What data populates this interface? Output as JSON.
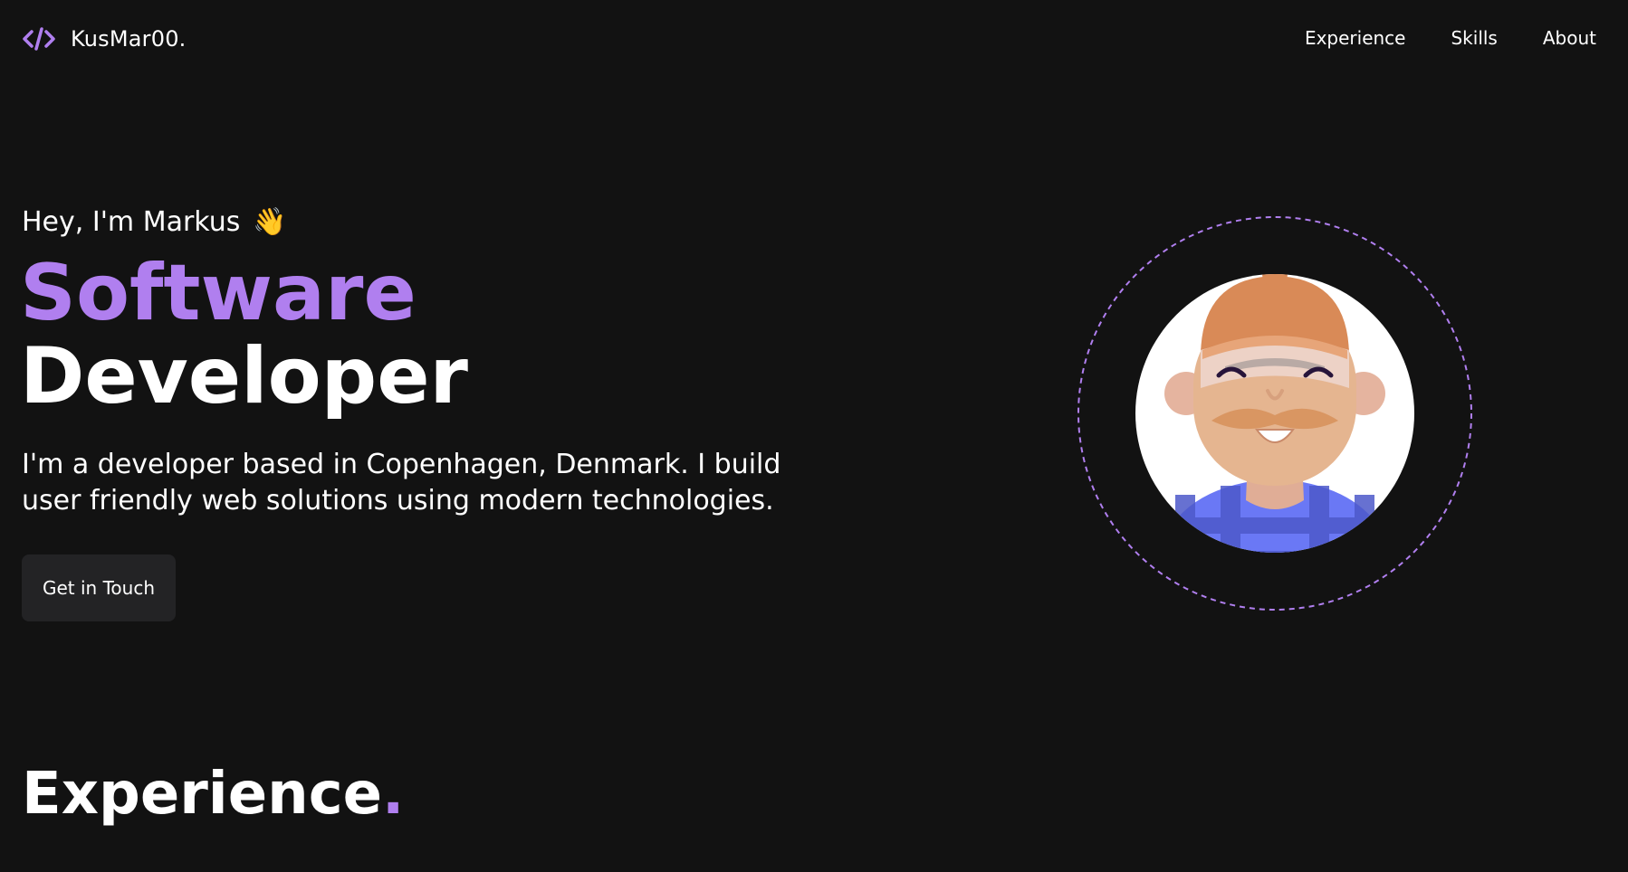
{
  "header": {
    "brand_name": "KusMar00.",
    "brand_icon": "code-brackets-icon",
    "accent_color": "#b07fef",
    "nav": [
      {
        "label": "Experience"
      },
      {
        "label": "Skills"
      },
      {
        "label": "About"
      }
    ]
  },
  "hero": {
    "greeting": "Hey, I'm Markus",
    "wave_emoji": "👋",
    "title_accent": "Software",
    "title_main": "Developer",
    "intro_line1": "I'm a developer based in Copenhagen, Denmark. I build",
    "intro_line2": "user friendly web solutions using modern technologies.",
    "cta_label": "Get in Touch",
    "avatar_icon": "cartoon-avatar-icon"
  },
  "sections": {
    "experience_title": "Experience",
    "experience_dot": "."
  },
  "colors": {
    "background": "#121212",
    "accent": "#b07fef",
    "button_bg": "#232325"
  }
}
